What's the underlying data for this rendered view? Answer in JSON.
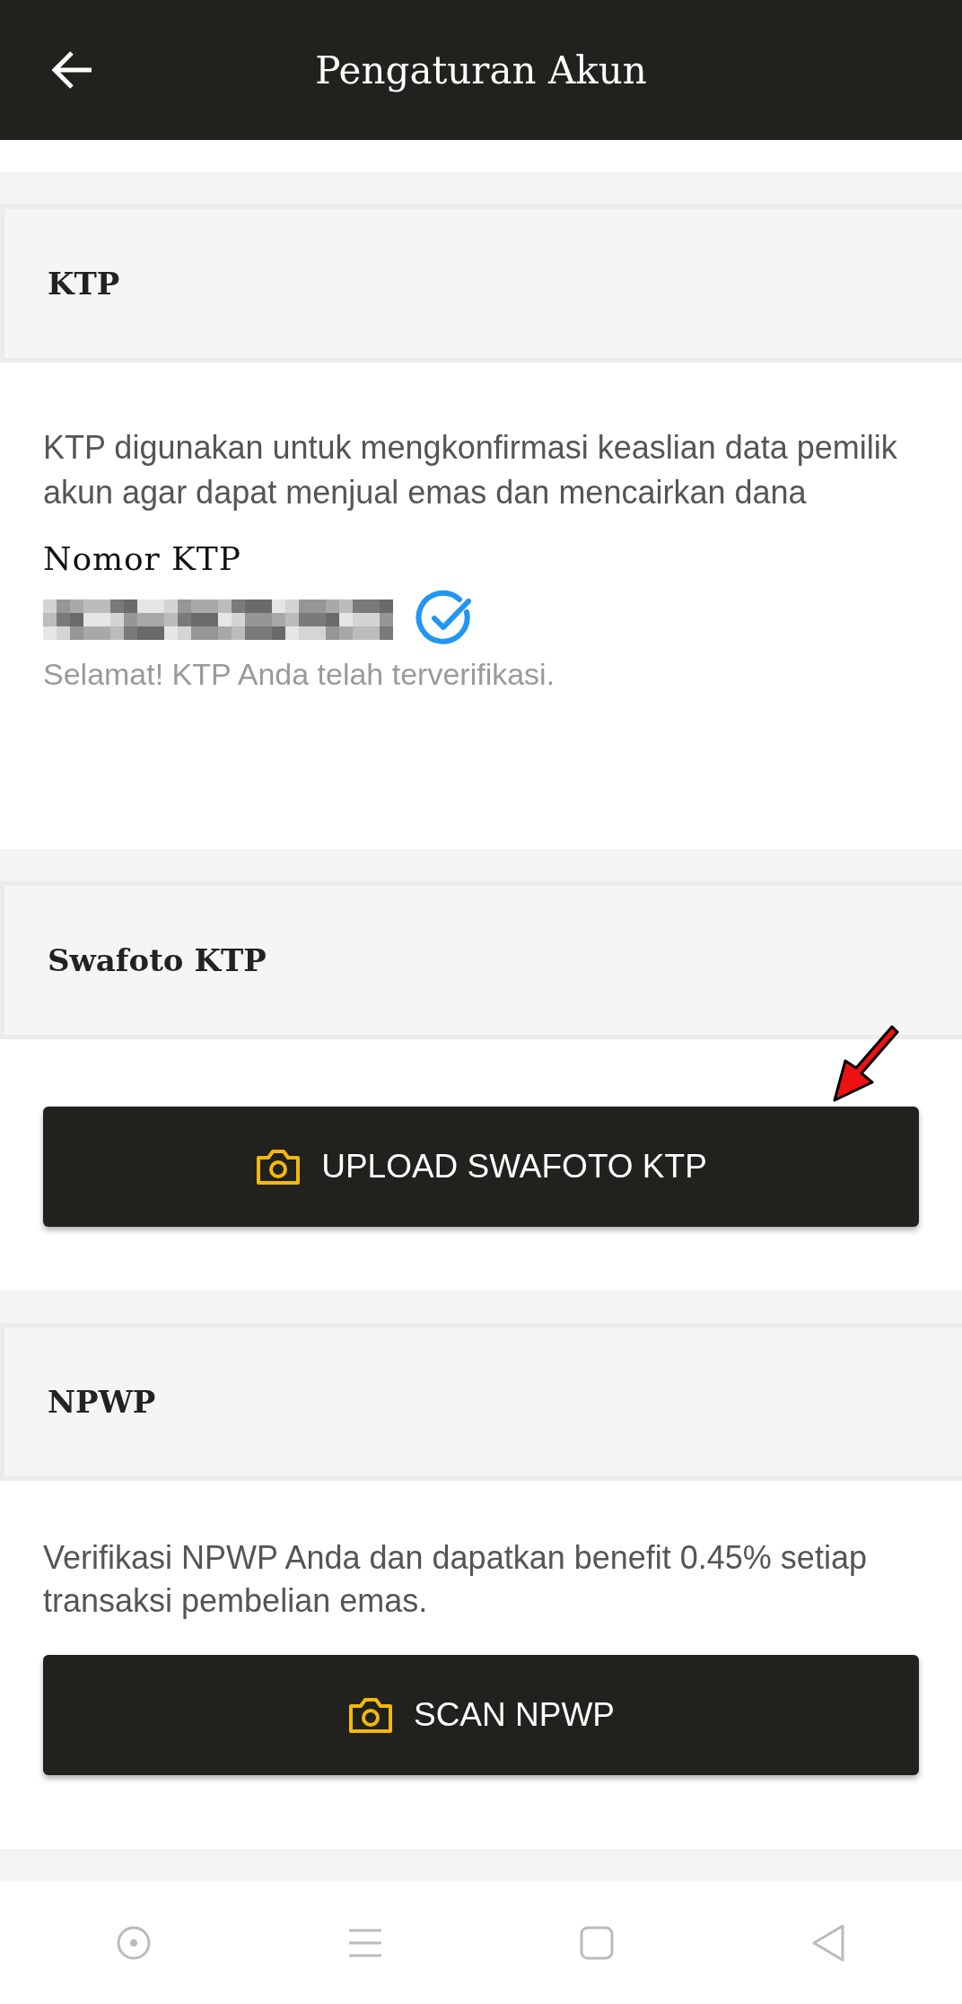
{
  "app_bar": {
    "title": "Pengaturan Akun"
  },
  "sections": [
    {
      "kind": "ktp",
      "heading": "KTP",
      "description": "KTP digunakan untuk mengkonfirmasi keaslian data pemilik akun agar dapat menjual emas dan mencairkan dana",
      "field_label": "Nomor KTP",
      "verified": true,
      "status": "Selamat! KTP Anda telah terverifikasi."
    },
    {
      "kind": "upload",
      "heading": "Swafoto KTP",
      "button": "UPLOAD SWAFOTO KTP",
      "pointer_arrow": true
    },
    {
      "kind": "upload",
      "heading": "NPWP",
      "description": "Verifikasi NPWP Anda dan dapatkan benefit 0.45% setiap transaksi pembelian emas.",
      "button": "SCAN NPWP",
      "pointer_arrow": false
    }
  ]
}
